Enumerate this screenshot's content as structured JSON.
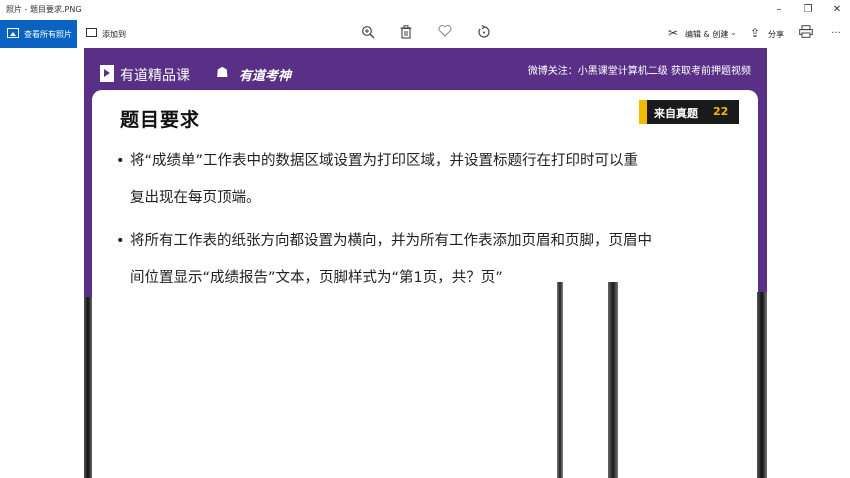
{
  "window": {
    "title": "照片 - 题目要求.PNG",
    "minimize": "–",
    "restore": "❐",
    "close": "✕"
  },
  "toolbar": {
    "view_all_label": "查看所有照片",
    "add_to_label": "添加到",
    "edit_create_label": "编辑 & 创建",
    "share_label": "分享",
    "more_label": "···"
  },
  "photo": {
    "brand1": "有道精品课",
    "brand2": "有道考神",
    "banner_right": "微博关注：小黑课堂计算机二级  获取考前押题视频",
    "heading": "题目要求",
    "badge_text": "来自真题",
    "badge_number": "22",
    "bullet": "•",
    "para1_line1": "将“成绩单”工作表中的数据区域设置为打印区域，并设置标题行在打印时可以重",
    "para1_line2": "复出现在每页顶端。",
    "para2_line1": "将所有工作表的纸张方向都设置为横向，并为所有工作表添加页眉和页脚，页眉中",
    "para2_line2": "间位置显示“成绩报告”文本，页脚样式为“第1页，共？页”"
  }
}
